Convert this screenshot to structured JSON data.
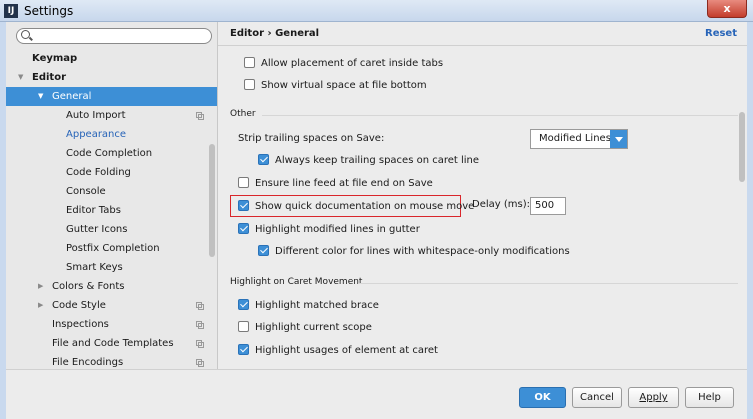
{
  "window": {
    "title": "Settings",
    "close_label": "x"
  },
  "search": {
    "placeholder": ""
  },
  "sidebar": {
    "items": [
      {
        "label": "Keymap",
        "level": 0,
        "bold": true
      },
      {
        "label": "Editor",
        "level": 0,
        "bold": true,
        "arrow": "▼"
      },
      {
        "label": "General",
        "level": 1,
        "arrow": "▼",
        "selected": true
      },
      {
        "label": "Auto Import",
        "level": 2,
        "copy": true
      },
      {
        "label": "Appearance",
        "level": 2,
        "link": true
      },
      {
        "label": "Code Completion",
        "level": 2
      },
      {
        "label": "Code Folding",
        "level": 2
      },
      {
        "label": "Console",
        "level": 2
      },
      {
        "label": "Editor Tabs",
        "level": 2
      },
      {
        "label": "Gutter Icons",
        "level": 2
      },
      {
        "label": "Postfix Completion",
        "level": 2
      },
      {
        "label": "Smart Keys",
        "level": 2
      },
      {
        "label": "Colors & Fonts",
        "level": 1,
        "arrow": "▶"
      },
      {
        "label": "Code Style",
        "level": 1,
        "arrow": "▶",
        "copy": true
      },
      {
        "label": "Inspections",
        "level": 1,
        "copy": true
      },
      {
        "label": "File and Code Templates",
        "level": 1,
        "copy": true
      },
      {
        "label": "File Encodings",
        "level": 1,
        "copy": true
      }
    ]
  },
  "header": {
    "breadcrumb": "Editor › General",
    "reset_label": "Reset"
  },
  "options": {
    "caret_in_tabs": "Allow placement of caret inside tabs",
    "virtual_space": "Show virtual space at file bottom",
    "other_section": "Other",
    "strip_label": "Strip trailing spaces on Save:",
    "strip_value": "Modified Lines",
    "keep_trailing": "Always keep trailing spaces on caret line",
    "ensure_line_feed": "Ensure line feed at file end on Save",
    "quick_doc": "Show quick documentation on mouse move",
    "delay_label": "Delay (ms):",
    "delay_value": "500",
    "highlight_modified": "Highlight modified lines in gutter",
    "different_color": "Different color for lines with whitespace-only modifications",
    "caret_section": "Highlight on Caret Movement",
    "matched_brace": "Highlight matched brace",
    "current_scope": "Highlight current scope",
    "usages": "Highlight usages of element at caret"
  },
  "footer": {
    "ok": "OK",
    "cancel": "Cancel",
    "apply": "Apply",
    "help": "Help"
  },
  "colors": {
    "accent": "#3d8fd6",
    "highlight_border": "#d9262b",
    "link": "#2764b8"
  }
}
